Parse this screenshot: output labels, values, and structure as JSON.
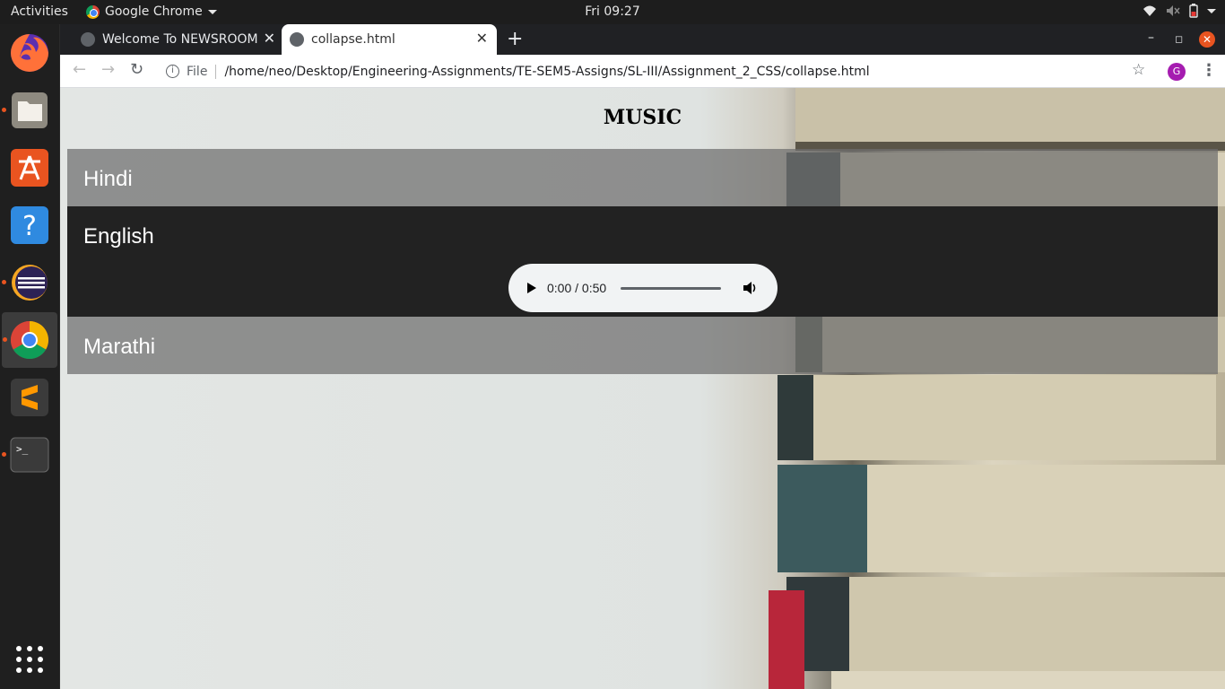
{
  "topbar": {
    "activities": "Activities",
    "app_name": "Google Chrome",
    "clock": "Fri 09:27"
  },
  "dock": {
    "apps": [
      "firefox-icon",
      "files-icon",
      "software-icon",
      "help-icon",
      "eclipse-icon",
      "chrome-icon",
      "sublime-icon",
      "terminal-icon",
      "apps-grid-icon"
    ]
  },
  "browser": {
    "tabs": [
      {
        "title": "Welcome To NEWSROOM",
        "active": false
      },
      {
        "title": "collapse.html",
        "active": true
      }
    ],
    "address": {
      "scheme_label": "File",
      "url": "/home/neo/Desktop/Engineering-Assignments/TE-SEM5-Assigns/SL-III/Assignment_2_CSS/collapse.html"
    },
    "profile_initial": "G"
  },
  "page": {
    "title": "MUSIC",
    "sections": [
      {
        "label": "Hindi",
        "expanded": false
      },
      {
        "label": "English",
        "expanded": true
      },
      {
        "label": "Marathi",
        "expanded": false
      }
    ],
    "audio": {
      "time": "0:00 / 0:50",
      "progress": 0
    }
  },
  "colors": {
    "accent": "#e95420",
    "panel_open": "#222222",
    "panel_closed": "#6e6e6e"
  }
}
